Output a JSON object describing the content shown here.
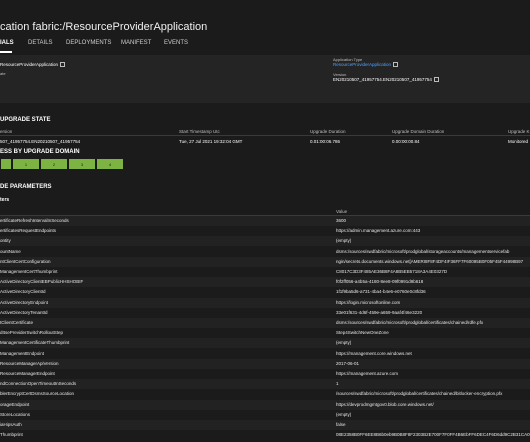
{
  "header": {
    "title": "cation fabric:/ResourceProviderApplication"
  },
  "tabs": [
    {
      "label": "IALS"
    },
    {
      "label": "DETAILS"
    },
    {
      "label": "DEPLOYMENTS"
    },
    {
      "label": "MANIFEST"
    },
    {
      "label": "EVENTS"
    }
  ],
  "info": {
    "name_value": "ResourceProviderApplication",
    "label2": "ate",
    "app_type_label": "Application Type",
    "app_type_value": "ResourceProviderApplication",
    "version_label": "Version",
    "version_value": "EN20210507_41957754.EN20210507_41957754"
  },
  "upgrade": {
    "section_title": "UPGRADE STATE",
    "columns": [
      "ersion",
      "Start Timestamp Utc",
      "Upgrade Duration",
      "Upgrade Domain Duration",
      "Upgrade K"
    ],
    "row": [
      "507_41957754.EN20210507_41957754",
      "Tue, 27 Jul 2021 19:32:04 GMT",
      "0.01:00:06.786",
      "0.00:00:00.84",
      "Monitored"
    ]
  },
  "domains": {
    "title": "ESS BY UPGRADE DOMAIN",
    "items": [
      "",
      "1",
      "2",
      "3",
      "4"
    ]
  },
  "params": {
    "section_title": "DE PARAMETERS",
    "sub_title": "ters",
    "value_header": "Value",
    "rows": [
      {
        "name": "ertificateRefreshIntervalInSeconds",
        "value": "3600"
      },
      {
        "name": "ertificatesRequestEndpoints",
        "value": "https://admin.management.azure.com:443"
      },
      {
        "name": "ontity",
        "value": "(empty)"
      },
      {
        "name": "ountName",
        "value": "dsms:/sources/swdfabric/microsoft/prodglobal/storageaccounts/managementservicefab"
      },
      {
        "name": "ntClientCertConfiguration",
        "value": "ngin/secrets.documents.windows.net[AMERI8F8F4DF4IF36FF7F60095B0F05F45F44998B97"
      },
      {
        "name": "ManagementCertThumbprint",
        "value": "C8017C3D3F485AE36B8F4A8B5EB5718A3A4E0327D"
      },
      {
        "name": "ActiveDirectoryClientEBPublicHHSHOBIF",
        "value": "f0f2ff056-a4b5a-4180-8ee8-09f0991d9b618"
      },
      {
        "name": "ActiveDirectoryClientId",
        "value": "1f1f9ba5d6-a731-4ba4-b4e6-e0760e0c8fd36"
      },
      {
        "name": "ActiveDirectoryEndpoint",
        "value": "https://login.microsoftonline.com"
      },
      {
        "name": "ActiveDirectoryTenantId",
        "value": "33e01f631-4d6f-459e-a659-9aaf4f46e3220"
      },
      {
        "name": "tClientCertificate",
        "value": "dsms:/sources/swdfabric/microsoft/prodglobal/certificates/chained/rdfe.pfx"
      },
      {
        "name": "dItsePreviderSwitchRolloutStep",
        "value": "Step4SwitchNewOneZone"
      },
      {
        "name": "ManagementCertificateThumbprint",
        "value": "(empty)"
      },
      {
        "name": "ManagementEndpoint",
        "value": "https://management.core.windows.net"
      },
      {
        "name": "ResourceManagerApiVersion",
        "value": "2017-06-01"
      },
      {
        "name": "ResourceManagerEndpoint",
        "value": "https://management.azure.com"
      },
      {
        "name": "ndConnectionOpenTimeoutInSeconds",
        "value": "1"
      },
      {
        "name": "blerEncryptCertDsmsSourceLocation",
        "value": "/sources/swdfabric/microsoft/prodglobal/certificates/chained/bitlocker-encryption.pfx"
      },
      {
        "name": "orageEndpoint",
        "value": "https://devprodmgmtgov0.blob.core.windows.net/"
      },
      {
        "name": "StoreLocations",
        "value": "(empty)"
      },
      {
        "name": "iaHipsAuth",
        "value": "false"
      },
      {
        "name": "Thumbprint",
        "value": "08E2358B0FF6EE8B6b0eb9B0B8F8F2303B2E700F7F0FF4B6EbFF6DEC4F6D6dd9C2B31CA09FF7F"
      }
    ]
  }
}
